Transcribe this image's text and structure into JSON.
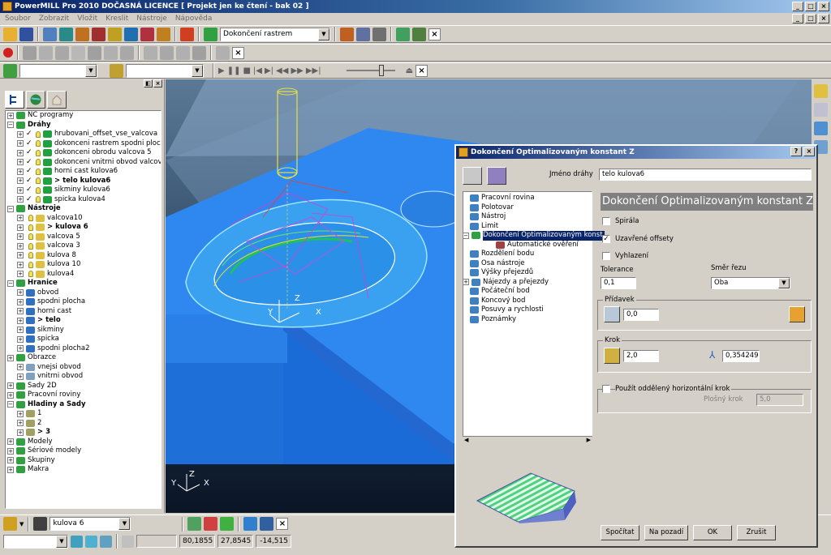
{
  "window": {
    "title": "PowerMILL Pro 2010 DOČASNÁ LICENCE  [ Projekt jen ke čtení - bak 02 ]"
  },
  "menu": [
    "Soubor",
    "Zobrazit",
    "Vložit",
    "Kreslit",
    "Nástroje",
    "Nápověda"
  ],
  "toolbar1": {
    "strategy_combo": "Dokončení rastrem"
  },
  "explorer": {
    "tree": [
      {
        "label": "NC programy",
        "level": 0,
        "kind": "folder"
      },
      {
        "label": "Dráhy",
        "level": 0,
        "kind": "folder",
        "bold": true
      },
      {
        "label": "hrubovani_offset_vse_valcova",
        "level": 1,
        "kind": "tp"
      },
      {
        "label": "dokonceni rastrem spodni ploch",
        "level": 1,
        "kind": "tp"
      },
      {
        "label": "dokonceni obrodu valcova 5",
        "level": 1,
        "kind": "tp"
      },
      {
        "label": "dokonceni vnitrni obvod valcov",
        "level": 1,
        "kind": "tp"
      },
      {
        "label": "horni cast kulova6",
        "level": 1,
        "kind": "tp"
      },
      {
        "label": "> telo kulova6",
        "level": 1,
        "kind": "tp",
        "bold": true
      },
      {
        "label": "sikminy kulova6",
        "level": 1,
        "kind": "tp"
      },
      {
        "label": "spicka kulova4",
        "level": 1,
        "kind": "tp"
      },
      {
        "label": "Nástroje",
        "level": 0,
        "kind": "folder",
        "bold": true
      },
      {
        "label": "valcova10",
        "level": 1,
        "kind": "tool"
      },
      {
        "label": "> kulova 6",
        "level": 1,
        "kind": "tool",
        "bold": true
      },
      {
        "label": "valcova 5",
        "level": 1,
        "kind": "tool"
      },
      {
        "label": "valcova 3",
        "level": 1,
        "kind": "tool"
      },
      {
        "label": "kulova 8",
        "level": 1,
        "kind": "tool"
      },
      {
        "label": "kulova 10",
        "level": 1,
        "kind": "tool"
      },
      {
        "label": "kulova4",
        "level": 1,
        "kind": "tool"
      },
      {
        "label": "Hranice",
        "level": 0,
        "kind": "folder",
        "bold": true
      },
      {
        "label": "obvod",
        "level": 1,
        "kind": "bnd"
      },
      {
        "label": "spodni plocha",
        "level": 1,
        "kind": "bnd"
      },
      {
        "label": "horni cast",
        "level": 1,
        "kind": "bnd"
      },
      {
        "label": "> telo",
        "level": 1,
        "kind": "bnd",
        "bold": true
      },
      {
        "label": "sikminy",
        "level": 1,
        "kind": "bnd"
      },
      {
        "label": "spicka",
        "level": 1,
        "kind": "bnd"
      },
      {
        "label": "spodni plocha2",
        "level": 1,
        "kind": "bnd"
      },
      {
        "label": "Obrazce",
        "level": 0,
        "kind": "folder"
      },
      {
        "label": "vnejsi obvod",
        "level": 1,
        "kind": "pat"
      },
      {
        "label": "vnitrni obvod",
        "level": 1,
        "kind": "pat"
      },
      {
        "label": "Sady 2D",
        "level": 0,
        "kind": "folder"
      },
      {
        "label": "Pracovní roviny",
        "level": 0,
        "kind": "folder"
      },
      {
        "label": "Hladiny a Sady",
        "level": 0,
        "kind": "folder",
        "bold": true
      },
      {
        "label": "1",
        "level": 1,
        "kind": "lvl"
      },
      {
        "label": "2",
        "level": 1,
        "kind": "lvl"
      },
      {
        "label": "> 3",
        "level": 1,
        "kind": "lvl",
        "bold": true
      },
      {
        "label": "Modely",
        "level": 0,
        "kind": "folder"
      },
      {
        "label": "Sériové modely",
        "level": 0,
        "kind": "folder"
      },
      {
        "label": "Skupiny",
        "level": 0,
        "kind": "folder"
      },
      {
        "label": "Makra",
        "level": 0,
        "kind": "folder"
      }
    ]
  },
  "viewport": {
    "axis_labels": [
      "X",
      "Y",
      "Z"
    ]
  },
  "bottom": {
    "tool_combo": "kulova 6"
  },
  "status": {
    "x": "80,1855",
    "y": "27,8545",
    "z": "-14,515"
  },
  "dialog": {
    "title": "Dokončení Optimalizovaným konstant Z",
    "toolpath_name_label": "Jméno dráhy",
    "toolpath_name_value": "telo kulova6",
    "heading": "Dokončení Optimalizovaným konstant Z",
    "tree": [
      {
        "label": "Pracovní rovina",
        "level": 0
      },
      {
        "label": "Polotovar",
        "level": 0
      },
      {
        "label": "Nástroj",
        "level": 0
      },
      {
        "label": "Limit",
        "level": 0
      },
      {
        "label": "Dokončení Optimalizovaným konst",
        "level": 0,
        "selected": true,
        "expander": true
      },
      {
        "label": "Automatické ověření",
        "level": 1
      },
      {
        "label": "Rozdělení bodu",
        "level": 0
      },
      {
        "label": "Osa nástroje",
        "level": 0
      },
      {
        "label": "Výšky přejezdů",
        "level": 0
      },
      {
        "label": "Nájezdy a přejezdy",
        "level": 0,
        "expander": true
      },
      {
        "label": "Počáteční bod",
        "level": 0
      },
      {
        "label": "Koncový bod",
        "level": 0
      },
      {
        "label": "Posuvy a rychlosti",
        "level": 0
      },
      {
        "label": "Poznámky",
        "level": 0
      }
    ],
    "spirala_label": "Spirála",
    "spirala_checked": false,
    "uzavrene_label": "Uzavřené offsety",
    "uzavrene_checked": true,
    "vyhlazeni_label": "Vyhlazení",
    "vyhlazeni_checked": false,
    "tolerance_label": "Tolerance",
    "tolerance_value": "0,1",
    "smer_label": "Směr řezu",
    "smer_value": "Oba",
    "pridavek_label": "Přídavek",
    "pridavek_value": "0,0",
    "krok_label": "Krok",
    "krok_value": "2,0",
    "krok2_value": "0,354249",
    "oddeleny_label": "Použít oddělený horizontální krok",
    "oddeleny_checked": false,
    "plosny_label": "Plošný krok",
    "plosny_value": "5,0",
    "buttons": {
      "spocitat": "Spočítat",
      "na_pozadi": "Na pozadí",
      "ok": "OK",
      "zrusit": "Zrušit"
    }
  }
}
